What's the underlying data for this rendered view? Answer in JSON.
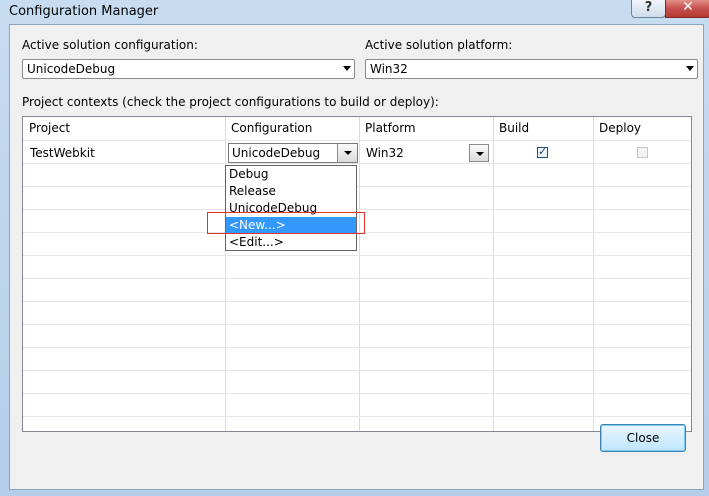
{
  "window": {
    "title": "Configuration Manager",
    "help_label": "?",
    "close_x_label": "✕"
  },
  "active_config": {
    "label": "Active solution configuration:",
    "value": "UnicodeDebug"
  },
  "active_platform": {
    "label": "Active solution platform:",
    "value": "Win32"
  },
  "contexts_label": "Project contexts (check the project configurations to build or deploy):",
  "grid": {
    "headers": [
      "Project",
      "Configuration",
      "Platform",
      "Build",
      "Deploy"
    ],
    "rows": [
      {
        "project": "TestWebkit",
        "configuration": "UnicodeDebug",
        "platform": "Win32",
        "build": true,
        "deploy": false
      }
    ]
  },
  "config_dropdown": {
    "options": [
      "Debug",
      "Release",
      "UnicodeDebug",
      "<New...>",
      "<Edit...>"
    ],
    "highlighted": "<New...>"
  },
  "buttons": {
    "close": "Close"
  },
  "colors": {
    "selection": "#3399ff",
    "annotation_box": "#e03030"
  }
}
